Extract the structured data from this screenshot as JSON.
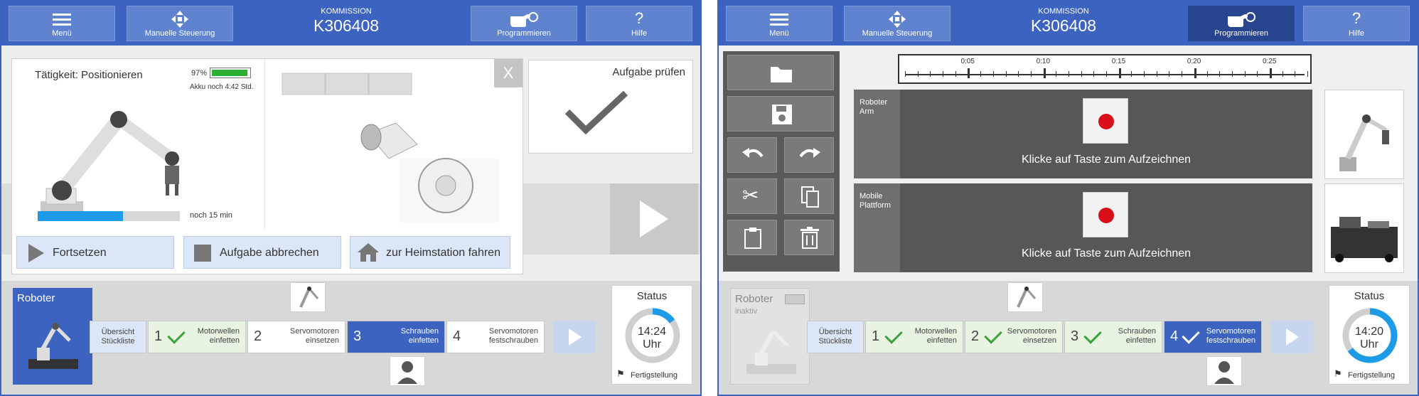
{
  "colors": {
    "accent": "#3b63bf",
    "accent_dark": "#27468f",
    "button": "#6083cf",
    "done": "#e8f3e2",
    "progress": "#1e9be6",
    "record": "#d80f1a",
    "battery": "#2db034"
  },
  "screen1": {
    "top": {
      "menu": "Menü",
      "manual": "Manuelle Steuerung",
      "komm_label": "KOMMISSION",
      "komm_value": "K306408",
      "program": "Programmieren",
      "help": "Hilfe"
    },
    "task": {
      "activity": "Tätigkeit: Positionieren",
      "battery_pct": "97%",
      "battery_level": 0.97,
      "battery_text": "Akku noch 4:42 Std.",
      "progress": 0.6,
      "remaining": "noch 15 min",
      "close": "X"
    },
    "check": {
      "title": "Aufgabe prüfen"
    },
    "actions": {
      "continue": "Fortsetzen",
      "abort": "Aufgabe abbrechen",
      "home": "zur Heimstation fahren"
    },
    "robot_tile": {
      "label": "Roboter"
    },
    "steps": [
      {
        "num": "",
        "text": "Übersicht\nStückliste"
      },
      {
        "num": "1",
        "text": "Motorwellen\neinfetten"
      },
      {
        "num": "2",
        "text": "Servomotoren\neinsetzen"
      },
      {
        "num": "3",
        "text": "Schrauben\neinfetten"
      },
      {
        "num": "4",
        "text": "Servomotoren\nfestschrauben"
      }
    ],
    "status": {
      "title": "Status",
      "time": "14:24",
      "unit": "Uhr",
      "progress": 0.15,
      "finish": "Fertigstellung"
    }
  },
  "screen2": {
    "top": {
      "menu": "Menü",
      "manual": "Manuelle Steuerung",
      "komm_label": "KOMMISSION",
      "komm_value": "K306408",
      "program": "Programmieren",
      "help": "Hilfe"
    },
    "timeline": {
      "ticks": [
        "0:05",
        "0:10",
        "0:15",
        "0:20",
        "0:25"
      ]
    },
    "tracks": [
      {
        "label": "Roboter\nArm",
        "message": "Klicke auf Taste zum Aufzeichnen"
      },
      {
        "label": "Mobile\nPlattform",
        "message": "Klicke auf Taste zum Aufzeichnen"
      }
    ],
    "robot_tile": {
      "label": "Roboter",
      "sublabel": "inaktiv"
    },
    "steps": [
      {
        "num": "",
        "text": "Übersicht\nStückliste"
      },
      {
        "num": "1",
        "text": "Motorwellen\neinfetten"
      },
      {
        "num": "2",
        "text": "Servomotoren\neinsetzen"
      },
      {
        "num": "3",
        "text": "Schrauben\neinfetten"
      },
      {
        "num": "4",
        "text": "Servomotoren\nfestschrauben"
      }
    ],
    "status": {
      "title": "Status",
      "time": "14:20",
      "unit": "Uhr",
      "progress": 0.65,
      "finish": "Fertigstellung"
    }
  }
}
